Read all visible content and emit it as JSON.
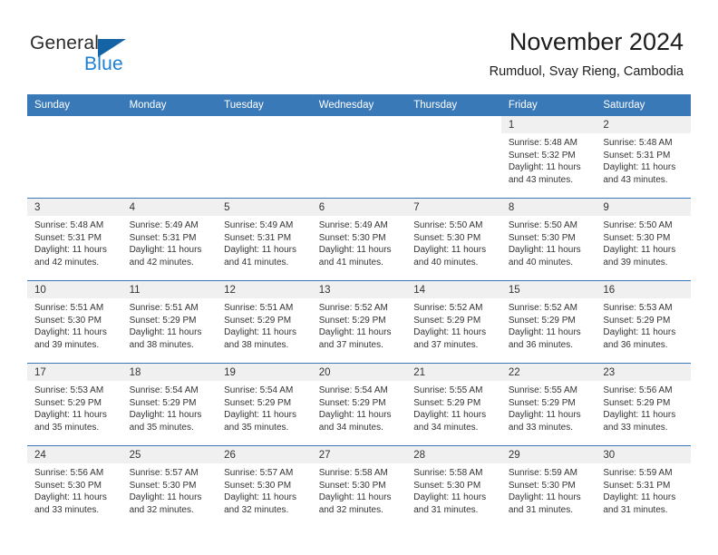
{
  "brand": {
    "name_part1": "General",
    "name_part2": "Blue",
    "triangle_icon": "triangle-icon",
    "accent_color": "#1b7fd4",
    "triangle_color": "#1464a5"
  },
  "header": {
    "title": "November 2024",
    "subtitle": "Rumduol, Svay Rieng, Cambodia"
  },
  "theme": {
    "header_row_bg": "#3a79b8",
    "daynum_band_bg": "#f0f0f0",
    "grid_line": "#3a79b8",
    "text": "#333333"
  },
  "weekdays": [
    "Sunday",
    "Monday",
    "Tuesday",
    "Wednesday",
    "Thursday",
    "Friday",
    "Saturday"
  ],
  "weeks": [
    [
      {
        "day": "",
        "sunrise": "",
        "sunset": "",
        "daylight_line1": "",
        "daylight_line2": ""
      },
      {
        "day": "",
        "sunrise": "",
        "sunset": "",
        "daylight_line1": "",
        "daylight_line2": ""
      },
      {
        "day": "",
        "sunrise": "",
        "sunset": "",
        "daylight_line1": "",
        "daylight_line2": ""
      },
      {
        "day": "",
        "sunrise": "",
        "sunset": "",
        "daylight_line1": "",
        "daylight_line2": ""
      },
      {
        "day": "",
        "sunrise": "",
        "sunset": "",
        "daylight_line1": "",
        "daylight_line2": ""
      },
      {
        "day": "1",
        "sunrise": "Sunrise: 5:48 AM",
        "sunset": "Sunset: 5:32 PM",
        "daylight_line1": "Daylight: 11 hours",
        "daylight_line2": "and 43 minutes."
      },
      {
        "day": "2",
        "sunrise": "Sunrise: 5:48 AM",
        "sunset": "Sunset: 5:31 PM",
        "daylight_line1": "Daylight: 11 hours",
        "daylight_line2": "and 43 minutes."
      }
    ],
    [
      {
        "day": "3",
        "sunrise": "Sunrise: 5:48 AM",
        "sunset": "Sunset: 5:31 PM",
        "daylight_line1": "Daylight: 11 hours",
        "daylight_line2": "and 42 minutes."
      },
      {
        "day": "4",
        "sunrise": "Sunrise: 5:49 AM",
        "sunset": "Sunset: 5:31 PM",
        "daylight_line1": "Daylight: 11 hours",
        "daylight_line2": "and 42 minutes."
      },
      {
        "day": "5",
        "sunrise": "Sunrise: 5:49 AM",
        "sunset": "Sunset: 5:31 PM",
        "daylight_line1": "Daylight: 11 hours",
        "daylight_line2": "and 41 minutes."
      },
      {
        "day": "6",
        "sunrise": "Sunrise: 5:49 AM",
        "sunset": "Sunset: 5:30 PM",
        "daylight_line1": "Daylight: 11 hours",
        "daylight_line2": "and 41 minutes."
      },
      {
        "day": "7",
        "sunrise": "Sunrise: 5:50 AM",
        "sunset": "Sunset: 5:30 PM",
        "daylight_line1": "Daylight: 11 hours",
        "daylight_line2": "and 40 minutes."
      },
      {
        "day": "8",
        "sunrise": "Sunrise: 5:50 AM",
        "sunset": "Sunset: 5:30 PM",
        "daylight_line1": "Daylight: 11 hours",
        "daylight_line2": "and 40 minutes."
      },
      {
        "day": "9",
        "sunrise": "Sunrise: 5:50 AM",
        "sunset": "Sunset: 5:30 PM",
        "daylight_line1": "Daylight: 11 hours",
        "daylight_line2": "and 39 minutes."
      }
    ],
    [
      {
        "day": "10",
        "sunrise": "Sunrise: 5:51 AM",
        "sunset": "Sunset: 5:30 PM",
        "daylight_line1": "Daylight: 11 hours",
        "daylight_line2": "and 39 minutes."
      },
      {
        "day": "11",
        "sunrise": "Sunrise: 5:51 AM",
        "sunset": "Sunset: 5:29 PM",
        "daylight_line1": "Daylight: 11 hours",
        "daylight_line2": "and 38 minutes."
      },
      {
        "day": "12",
        "sunrise": "Sunrise: 5:51 AM",
        "sunset": "Sunset: 5:29 PM",
        "daylight_line1": "Daylight: 11 hours",
        "daylight_line2": "and 38 minutes."
      },
      {
        "day": "13",
        "sunrise": "Sunrise: 5:52 AM",
        "sunset": "Sunset: 5:29 PM",
        "daylight_line1": "Daylight: 11 hours",
        "daylight_line2": "and 37 minutes."
      },
      {
        "day": "14",
        "sunrise": "Sunrise: 5:52 AM",
        "sunset": "Sunset: 5:29 PM",
        "daylight_line1": "Daylight: 11 hours",
        "daylight_line2": "and 37 minutes."
      },
      {
        "day": "15",
        "sunrise": "Sunrise: 5:52 AM",
        "sunset": "Sunset: 5:29 PM",
        "daylight_line1": "Daylight: 11 hours",
        "daylight_line2": "and 36 minutes."
      },
      {
        "day": "16",
        "sunrise": "Sunrise: 5:53 AM",
        "sunset": "Sunset: 5:29 PM",
        "daylight_line1": "Daylight: 11 hours",
        "daylight_line2": "and 36 minutes."
      }
    ],
    [
      {
        "day": "17",
        "sunrise": "Sunrise: 5:53 AM",
        "sunset": "Sunset: 5:29 PM",
        "daylight_line1": "Daylight: 11 hours",
        "daylight_line2": "and 35 minutes."
      },
      {
        "day": "18",
        "sunrise": "Sunrise: 5:54 AM",
        "sunset": "Sunset: 5:29 PM",
        "daylight_line1": "Daylight: 11 hours",
        "daylight_line2": "and 35 minutes."
      },
      {
        "day": "19",
        "sunrise": "Sunrise: 5:54 AM",
        "sunset": "Sunset: 5:29 PM",
        "daylight_line1": "Daylight: 11 hours",
        "daylight_line2": "and 35 minutes."
      },
      {
        "day": "20",
        "sunrise": "Sunrise: 5:54 AM",
        "sunset": "Sunset: 5:29 PM",
        "daylight_line1": "Daylight: 11 hours",
        "daylight_line2": "and 34 minutes."
      },
      {
        "day": "21",
        "sunrise": "Sunrise: 5:55 AM",
        "sunset": "Sunset: 5:29 PM",
        "daylight_line1": "Daylight: 11 hours",
        "daylight_line2": "and 34 minutes."
      },
      {
        "day": "22",
        "sunrise": "Sunrise: 5:55 AM",
        "sunset": "Sunset: 5:29 PM",
        "daylight_line1": "Daylight: 11 hours",
        "daylight_line2": "and 33 minutes."
      },
      {
        "day": "23",
        "sunrise": "Sunrise: 5:56 AM",
        "sunset": "Sunset: 5:29 PM",
        "daylight_line1": "Daylight: 11 hours",
        "daylight_line2": "and 33 minutes."
      }
    ],
    [
      {
        "day": "24",
        "sunrise": "Sunrise: 5:56 AM",
        "sunset": "Sunset: 5:30 PM",
        "daylight_line1": "Daylight: 11 hours",
        "daylight_line2": "and 33 minutes."
      },
      {
        "day": "25",
        "sunrise": "Sunrise: 5:57 AM",
        "sunset": "Sunset: 5:30 PM",
        "daylight_line1": "Daylight: 11 hours",
        "daylight_line2": "and 32 minutes."
      },
      {
        "day": "26",
        "sunrise": "Sunrise: 5:57 AM",
        "sunset": "Sunset: 5:30 PM",
        "daylight_line1": "Daylight: 11 hours",
        "daylight_line2": "and 32 minutes."
      },
      {
        "day": "27",
        "sunrise": "Sunrise: 5:58 AM",
        "sunset": "Sunset: 5:30 PM",
        "daylight_line1": "Daylight: 11 hours",
        "daylight_line2": "and 32 minutes."
      },
      {
        "day": "28",
        "sunrise": "Sunrise: 5:58 AM",
        "sunset": "Sunset: 5:30 PM",
        "daylight_line1": "Daylight: 11 hours",
        "daylight_line2": "and 31 minutes."
      },
      {
        "day": "29",
        "sunrise": "Sunrise: 5:59 AM",
        "sunset": "Sunset: 5:30 PM",
        "daylight_line1": "Daylight: 11 hours",
        "daylight_line2": "and 31 minutes."
      },
      {
        "day": "30",
        "sunrise": "Sunrise: 5:59 AM",
        "sunset": "Sunset: 5:31 PM",
        "daylight_line1": "Daylight: 11 hours",
        "daylight_line2": "and 31 minutes."
      }
    ]
  ]
}
